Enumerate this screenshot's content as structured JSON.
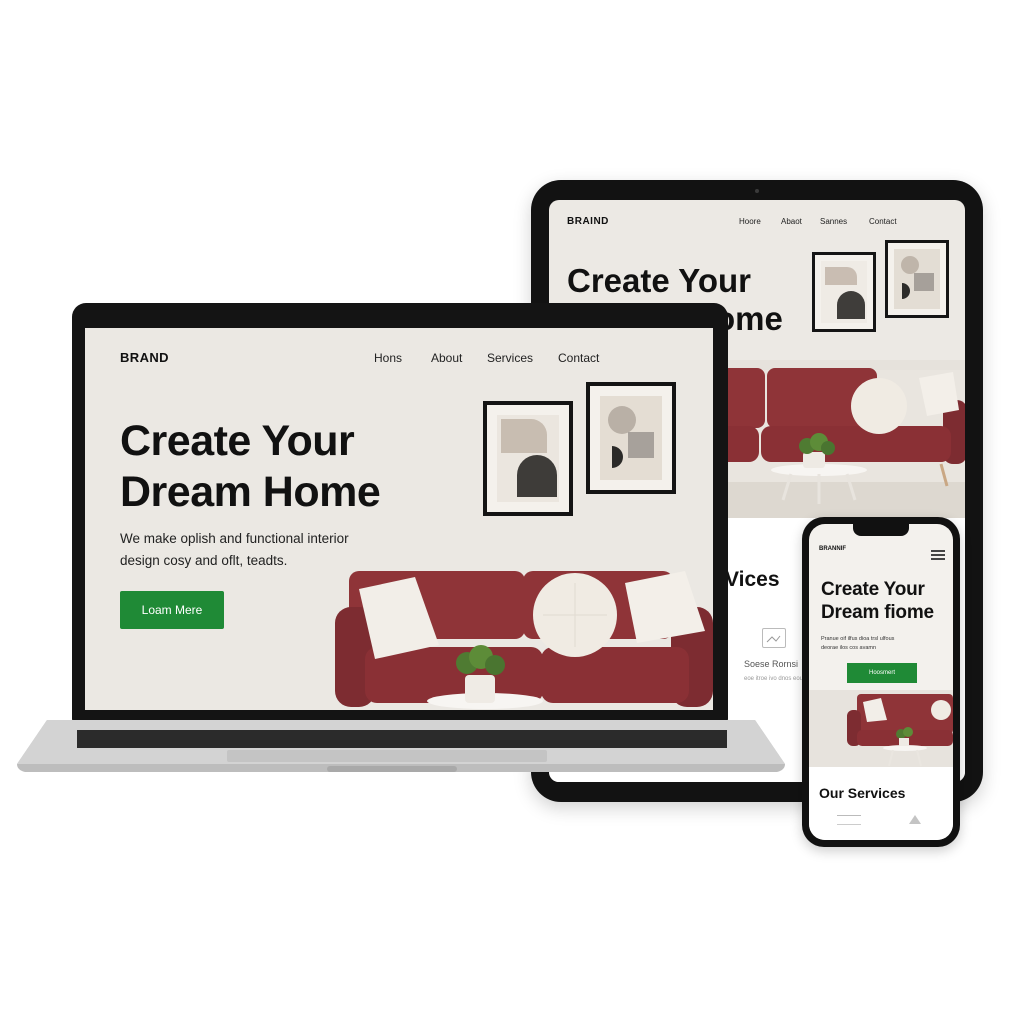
{
  "laptop": {
    "brand": "BRAND",
    "nav": [
      "Hons",
      "About",
      "Services",
      "Contact"
    ],
    "title_line1": "Create Your",
    "title_line2": "Dream Home",
    "subtitle_line1": "We make oplish and functional interior",
    "subtitle_line2": "design cosy and oflt, teadts.",
    "cta_label": "Loam Mere"
  },
  "tablet": {
    "brand": "BRAIND",
    "nav": [
      "Hoore",
      "Abaot",
      "Sannes",
      "Contact"
    ],
    "title_line1": "Create Your",
    "title_line2": "ome",
    "services_heading": "Vices",
    "service_name": "Soese Rornsi",
    "service_desc": "eoe itroe ivo dnos eous"
  },
  "phone": {
    "brand": "BRANNIF",
    "title_line1": "Create Your",
    "title_line2": "Dream fiome",
    "subtitle_line1": "Pranue oif ilfus dioa trsl ulfous",
    "subtitle_line2": "deorae ilos cos avamn",
    "cta_label": "Hoosmert",
    "services_heading": "Our Services"
  },
  "colors": {
    "accent_green": "#1f8a36",
    "sofa": "#8f3438",
    "wall": "#ebe8e3",
    "device_frame": "#141414"
  }
}
